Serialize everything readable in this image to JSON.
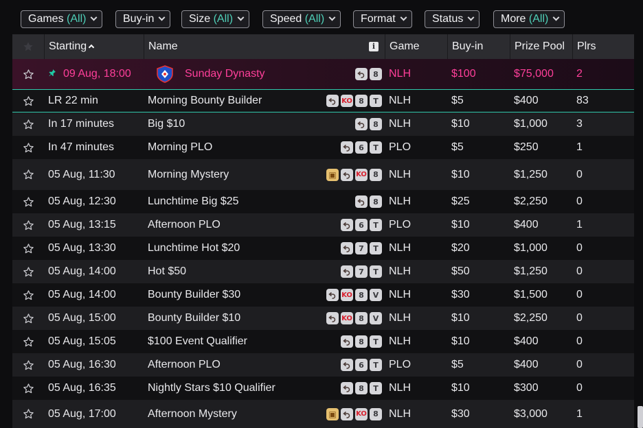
{
  "filters": [
    {
      "label": "Games",
      "all": "(All)"
    },
    {
      "label": "Buy-in",
      "all": ""
    },
    {
      "label": "Size",
      "all": "(All)"
    },
    {
      "label": "Speed",
      "all": "(All)"
    },
    {
      "label": "Format",
      "all": ""
    },
    {
      "label": "Status",
      "all": ""
    },
    {
      "label": "More",
      "all": "(All)"
    }
  ],
  "columns": {
    "starting": "Starting",
    "name": "Name",
    "info": "i",
    "game": "Game",
    "buyin": "Buy-in",
    "prize": "Prize Pool",
    "plrs": "Plrs"
  },
  "icons": {
    "star": "star-outline-icon",
    "pin": "pin-icon",
    "turn": "rebuy-arrow-icon",
    "chest": "treasure-chest-icon"
  },
  "colors": {
    "accent": "#4fd0b8",
    "featured": "#ff3f9a",
    "late_border": "#30c9ac"
  },
  "rows": [
    {
      "start": "09 Aug, 18:00",
      "name": "Sunday Dynasty",
      "badges": [
        "turn",
        "8"
      ],
      "game": "NLH",
      "buyin": "$100",
      "prize": "$75,000",
      "plrs": "2",
      "type": "featured"
    },
    {
      "start": "LR 22 min",
      "name": "Morning Bounty Builder",
      "badges": [
        "turn",
        "KO",
        "8",
        "T"
      ],
      "game": "NLH",
      "buyin": "$5",
      "prize": "$400",
      "plrs": "83",
      "type": "late"
    },
    {
      "start": "In 17 minutes",
      "name": "Big $10",
      "badges": [
        "turn",
        "8"
      ],
      "game": "NLH",
      "buyin": "$10",
      "prize": "$1,000",
      "plrs": "3",
      "type": "light"
    },
    {
      "start": "In 47 minutes",
      "name": "Morning PLO",
      "badges": [
        "turn",
        "6",
        "T"
      ],
      "game": "PLO",
      "buyin": "$5",
      "prize": "$250",
      "plrs": "1",
      "type": "dark"
    },
    {
      "start": "05 Aug, 11:30",
      "name": "Morning Mystery",
      "badges": [
        "chest",
        "turn",
        "KO",
        "8"
      ],
      "game": "NLH",
      "buyin": "$10",
      "prize": "$1,250",
      "plrs": "0",
      "type": "light"
    },
    {
      "start": "05 Aug, 12:30",
      "name": "Lunchtime Big $25",
      "badges": [
        "turn",
        "8"
      ],
      "game": "NLH",
      "buyin": "$25",
      "prize": "$2,250",
      "plrs": "0",
      "type": "dark"
    },
    {
      "start": "05 Aug, 13:15",
      "name": "Afternoon PLO",
      "badges": [
        "turn",
        "6",
        "T"
      ],
      "game": "PLO",
      "buyin": "$10",
      "prize": "$400",
      "plrs": "1",
      "type": "light"
    },
    {
      "start": "05 Aug, 13:30",
      "name": "Lunchtime Hot $20",
      "badges": [
        "turn",
        "7",
        "T"
      ],
      "game": "NLH",
      "buyin": "$20",
      "prize": "$1,000",
      "plrs": "0",
      "type": "dark"
    },
    {
      "start": "05 Aug, 14:00",
      "name": "Hot $50",
      "badges": [
        "turn",
        "7",
        "T"
      ],
      "game": "NLH",
      "buyin": "$50",
      "prize": "$1,250",
      "plrs": "0",
      "type": "light"
    },
    {
      "start": "05 Aug, 14:00",
      "name": "Bounty Builder $30",
      "badges": [
        "turn",
        "KO",
        "8",
        "V"
      ],
      "game": "NLH",
      "buyin": "$30",
      "prize": "$1,500",
      "plrs": "0",
      "type": "dark"
    },
    {
      "start": "05 Aug, 15:00",
      "name": "Bounty Builder $10",
      "badges": [
        "turn",
        "KO",
        "8",
        "V"
      ],
      "game": "NLH",
      "buyin": "$10",
      "prize": "$2,250",
      "plrs": "0",
      "type": "light"
    },
    {
      "start": "05 Aug, 15:05",
      "name": "$100 Event Qualifier",
      "badges": [
        "turn",
        "8",
        "T"
      ],
      "game": "NLH",
      "buyin": "$10",
      "prize": "$400",
      "plrs": "0",
      "type": "dark"
    },
    {
      "start": "05 Aug, 16:30",
      "name": "Afternoon PLO",
      "badges": [
        "turn",
        "6",
        "T"
      ],
      "game": "PLO",
      "buyin": "$5",
      "prize": "$400",
      "plrs": "0",
      "type": "light"
    },
    {
      "start": "05 Aug, 16:35",
      "name": "Nightly Stars $10 Qualifier",
      "badges": [
        "turn",
        "8",
        "T"
      ],
      "game": "NLH",
      "buyin": "$10",
      "prize": "$300",
      "plrs": "0",
      "type": "dark"
    },
    {
      "start": "05 Aug, 17:00",
      "name": "Afternoon Mystery",
      "badges": [
        "chest",
        "turn",
        "KO",
        "8"
      ],
      "game": "NLH",
      "buyin": "$30",
      "prize": "$3,000",
      "plrs": "1",
      "type": "light"
    }
  ]
}
